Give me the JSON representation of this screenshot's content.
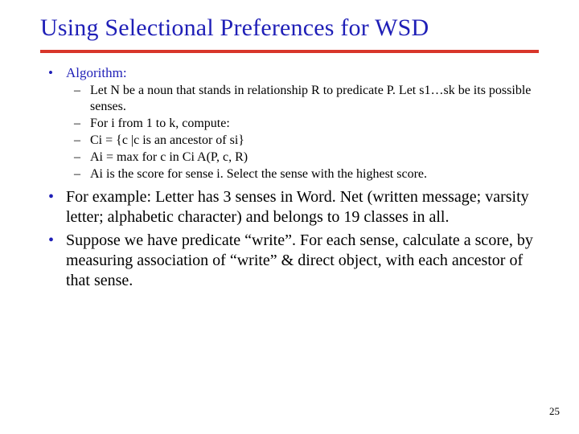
{
  "title": "Using Selectional Preferences for WSD",
  "algorithm": {
    "label": "Algorithm:",
    "items": [
      "Let N be a noun that stands in relationship R to predicate P.   Let s1…sk be its possible senses.",
      "For i from 1 to k, compute:",
      "Ci = {c |c is an ancestor of si}",
      "Ai = max for c in Ci A(P, c, R)",
      "Ai is the score for sense i.   Select the sense with the highest score."
    ]
  },
  "example": "For example:  Letter has 3 senses in Word. Net (written message; varsity letter; alphabetic character) and belongs to 19 classes in all.",
  "suppose": "Suppose we have predicate “write”.   For each sense, calculate a score, by measuring association of “write” & direct object, with each ancestor of that sense.",
  "page_number": "25"
}
